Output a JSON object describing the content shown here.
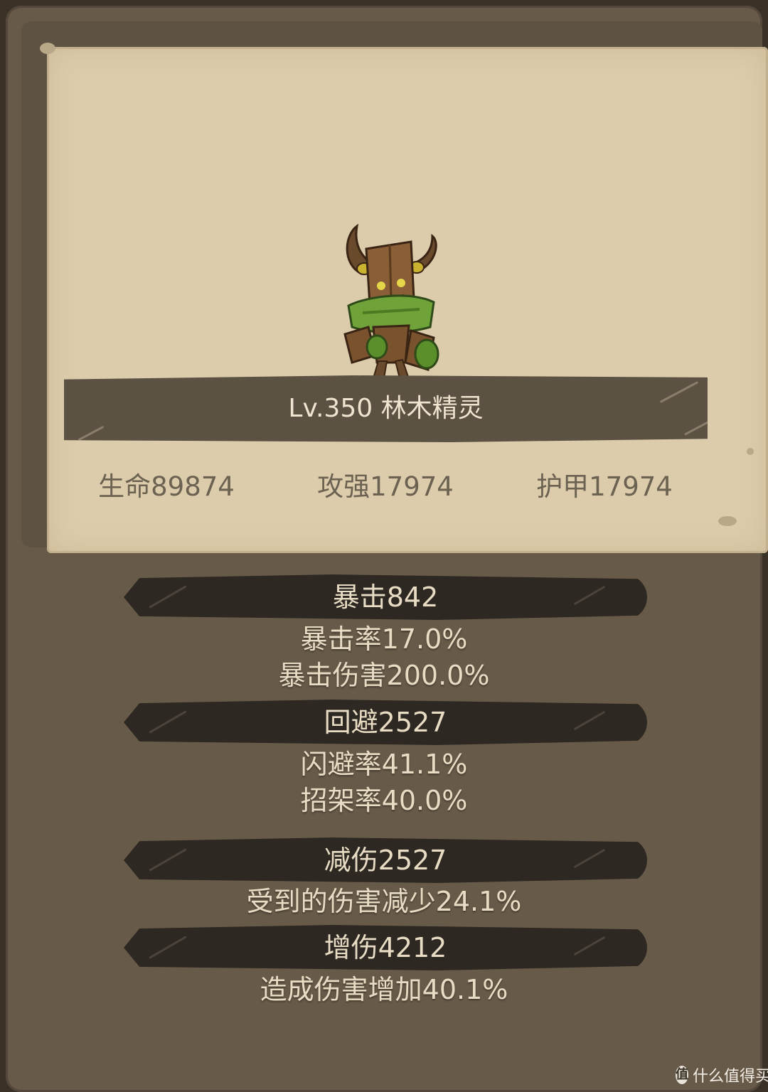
{
  "monster": {
    "icon": "wood-spirit-icon",
    "name_line": "Lv.350 林木精灵"
  },
  "base_stats": [
    {
      "text": "生命89874"
    },
    {
      "text": "攻强17974"
    },
    {
      "text": "护甲17974"
    }
  ],
  "groups": [
    {
      "header": "暴击842",
      "details": [
        "暴击率17.0%",
        "暴击伤害200.0%"
      ]
    },
    {
      "header": "回避2527",
      "details": [
        "闪避率41.1%",
        "招架率40.0%"
      ]
    },
    {
      "header": "减伤2527",
      "details": [
        "受到的伤害减少24.1%"
      ]
    },
    {
      "header": "增伤4212",
      "details": [
        "造成伤害增加40.1%"
      ]
    }
  ],
  "watermark": {
    "icon_glyph": "值",
    "text": "什么值得买"
  }
}
